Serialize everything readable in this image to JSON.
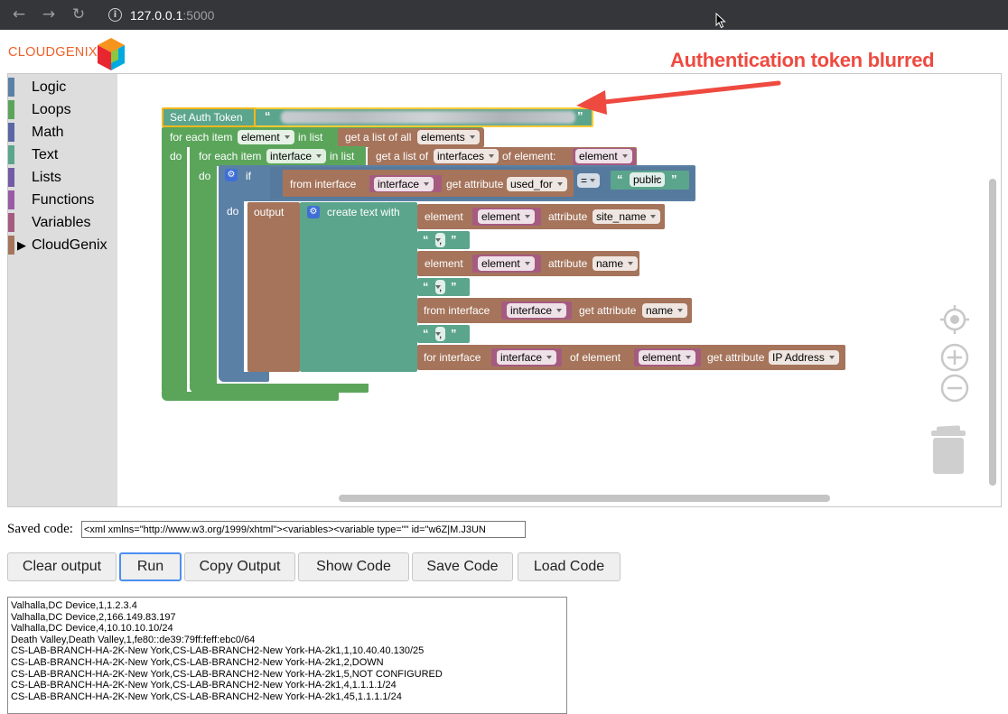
{
  "browser": {
    "url_host": "127.0.0.1",
    "url_port": ":5000"
  },
  "logo": {
    "text": "CLOUDGENIX"
  },
  "toolbox": {
    "categories": [
      {
        "label": "Logic",
        "color": "#5b80a5"
      },
      {
        "label": "Loops",
        "color": "#5ba55b"
      },
      {
        "label": "Math",
        "color": "#5b67a5"
      },
      {
        "label": "Text",
        "color": "#5ba58c"
      },
      {
        "label": "Lists",
        "color": "#745ba5"
      },
      {
        "label": "Functions",
        "color": "#995ba5"
      },
      {
        "label": "Variables",
        "color": "#a55b80"
      },
      {
        "label": "CloudGenix",
        "color": "#a5745b"
      }
    ]
  },
  "blocks": {
    "set_auth_token": "Set Auth Token",
    "open_quote": "“",
    "close_quote": "”",
    "for_each_item": "for each item",
    "in_list": "in list",
    "do": "do",
    "var_element": "element",
    "var_interface": "interface",
    "get_list_of_all": "get a list of all",
    "dd_elements": "elements",
    "get_list_of": "get a list of",
    "dd_interfaces": "interfaces",
    "of_element_colon": "of element:",
    "if": "if",
    "from_interface": "from interface",
    "get_attribute": "get attribute",
    "dd_used_for": "used_for",
    "dd_eq": "=",
    "public": "public",
    "output": "output",
    "create_text_with": "create text with",
    "element": "element",
    "attribute": "attribute",
    "dd_site_name": "site_name",
    "dd_name": "name",
    "comma": ",",
    "for_interface": "for interface",
    "of_element": "of element",
    "dd_ip_address": "IP Address"
  },
  "annotation": {
    "text": "Authentication token blurred"
  },
  "saved": {
    "label": "Saved code:",
    "value": "<xml xmlns=\"http://www.w3.org/1999/xhtml\"><variables><variable type=\"\" id=\"w6Z|M.J3UN"
  },
  "buttons": {
    "clear_output": "Clear output",
    "run": "Run",
    "copy_output": "Copy Output",
    "show_code": "Show Code",
    "save_code": "Save Code",
    "load_code": "Load Code"
  },
  "output_lines": [
    "Valhalla,DC Device,1,1.2.3.4",
    "Valhalla,DC Device,2,166.149.83.197",
    "Valhalla,DC Device,4,10.10.10.10/24",
    "Death Valley,Death Valley,1,fe80::de39:79ff:feff:ebc0/64",
    "CS-LAB-BRANCH-HA-2K-New York,CS-LAB-BRANCH2-New York-HA-2k1,1,10.40.40.130/25",
    "CS-LAB-BRANCH-HA-2K-New York,CS-LAB-BRANCH2-New York-HA-2k1,2,DOWN",
    "CS-LAB-BRANCH-HA-2K-New York,CS-LAB-BRANCH2-New York-HA-2k1,5,NOT CONFIGURED",
    "CS-LAB-BRANCH-HA-2K-New York,CS-LAB-BRANCH2-New York-HA-2k1,4,1.1.1.1/24",
    "CS-LAB-BRANCH-HA-2K-New York,CS-LAB-BRANCH2-New York-HA-2k1,45,1.1.1.1/24"
  ]
}
